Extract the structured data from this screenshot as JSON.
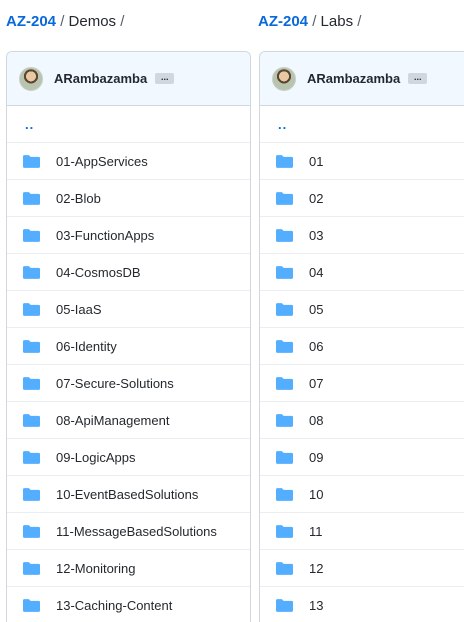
{
  "left": {
    "breadcrumb": {
      "repo": "AZ-204",
      "sep1": " / ",
      "dir": "Demos",
      "sep2": " /"
    },
    "author": "ARambazamba",
    "ellipsis": "...",
    "parent_link": "..",
    "folders": [
      "01-AppServices",
      "02-Blob",
      "03-FunctionApps",
      "04-CosmosDB",
      "05-IaaS",
      "06-Identity",
      "07-Secure-Solutions",
      "08-ApiManagement",
      "09-LogicApps",
      "10-EventBasedSolutions",
      "11-MessageBasedSolutions",
      "12-Monitoring",
      "13-Caching-Content"
    ]
  },
  "right": {
    "breadcrumb": {
      "repo": "AZ-204",
      "sep1": " / ",
      "dir": "Labs",
      "sep2": " /"
    },
    "author": "ARambazamba",
    "ellipsis": "...",
    "parent_link": "..",
    "folders": [
      "01",
      "02",
      "03",
      "04",
      "05",
      "06",
      "07",
      "08",
      "09",
      "10",
      "11",
      "12",
      "13"
    ]
  },
  "colors": {
    "link": "#0969da",
    "folder": "#54aeff",
    "header_bg": "#f2f8ff",
    "border": "#d0d7de"
  },
  "icons": {
    "folder": "folder-icon",
    "avatar": "avatar"
  }
}
